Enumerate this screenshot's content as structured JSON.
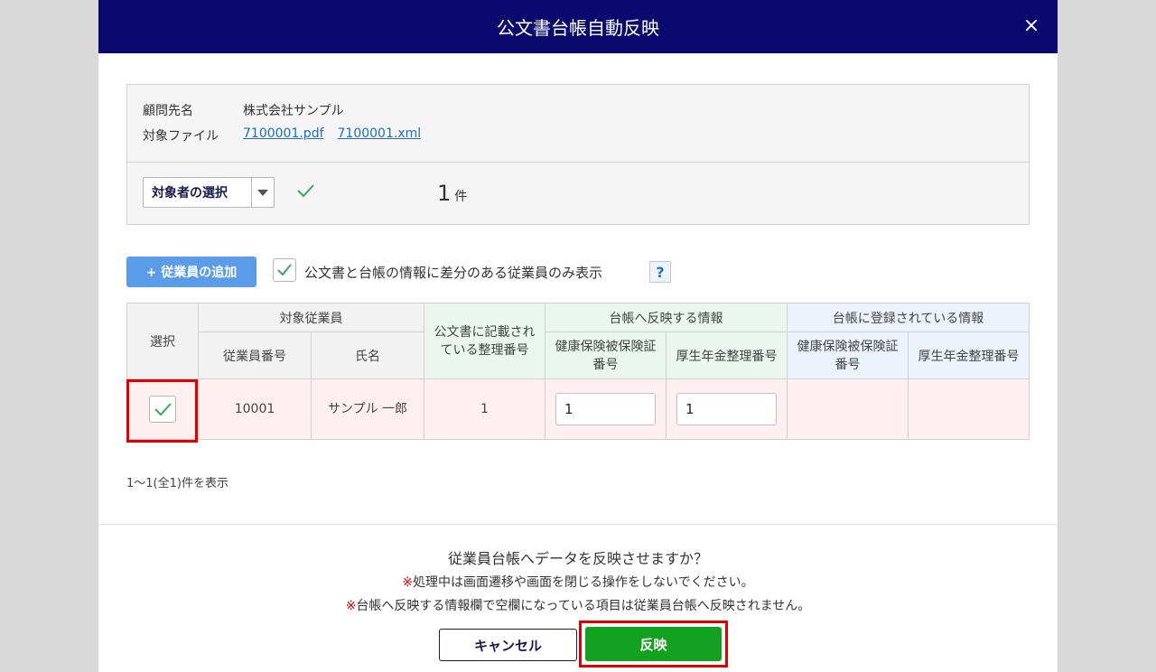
{
  "dialog": {
    "title": "公文書台帳自動反映",
    "close_icon": "×"
  },
  "info": {
    "client_label": "顧問先名",
    "client_value": "株式会社サンプル",
    "file_label": "対象ファイル",
    "files": [
      "7100001.pdf",
      "7100001.xml"
    ]
  },
  "target": {
    "select_label": "対象者の選択",
    "count_value": "1",
    "count_unit": "件"
  },
  "toolbar": {
    "add_button": "+ 従業員の追加",
    "filter_label": "公文書と台帳の情報に差分のある従業員のみ表示",
    "filter_checked": true,
    "help_icon": "?"
  },
  "table": {
    "headers": {
      "select": "選択",
      "target_employee": "対象従業員",
      "employee_no": "従業員番号",
      "name": "氏名",
      "doc_number": "公文書に記載されている整理番号",
      "reflect_group": "台帳へ反映する情報",
      "registered_group": "台帳に登録されている情報",
      "health_ins": "健康保険被保険証番号",
      "pension": "厚生年金整理番号"
    },
    "rows": [
      {
        "selected": true,
        "employee_no": "10001",
        "name": "サンプル 一郎",
        "doc_number": "1",
        "reflect_health": "1",
        "reflect_pension": "1",
        "registered_health": "",
        "registered_pension": ""
      }
    ]
  },
  "pager": {
    "text": "1〜1(全1)件を表示"
  },
  "footer": {
    "question": "従業員台帳へデータを反映させますか？",
    "note_mark": "※",
    "note1": "処理中は画面遷移や画面を閉じる操作をしないでください。",
    "note2": "台帳へ反映する情報欄で空欄になっている項目は従業員台帳へ反映されません。",
    "cancel_label": "キャンセル",
    "apply_label": "反映"
  },
  "colors": {
    "header_bg": "#0a0a6e",
    "apply_green": "#14a021",
    "add_blue": "#5b9ce8",
    "highlight_red": "#e00000",
    "row_pink": "#fef0f0"
  }
}
